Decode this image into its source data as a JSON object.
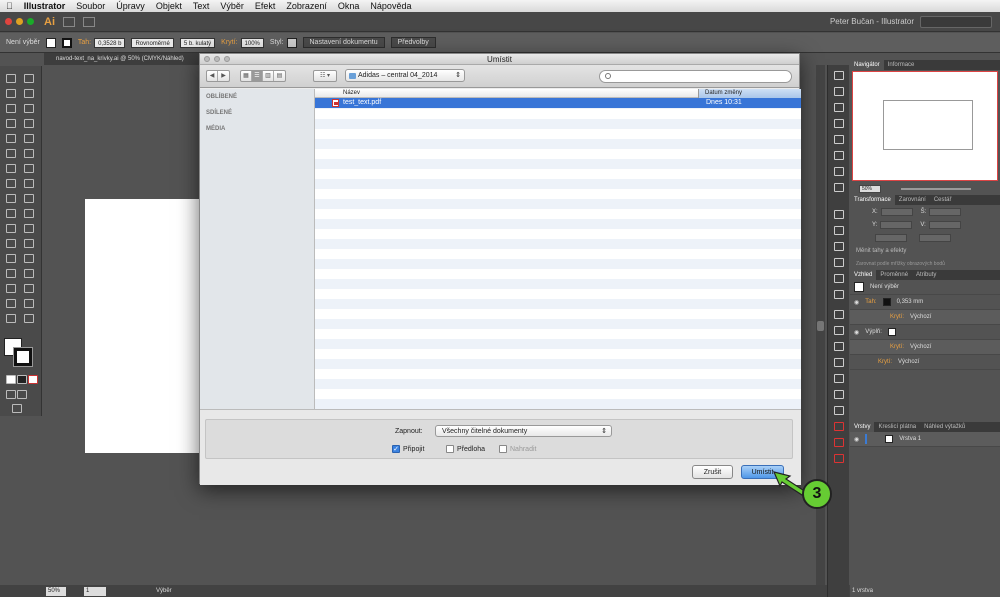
{
  "menubar": {
    "app": "Illustrator",
    "items": [
      "Soubor",
      "Úpravy",
      "Objekt",
      "Text",
      "Výběr",
      "Efekt",
      "Zobrazení",
      "Okna",
      "Nápověda"
    ]
  },
  "appbar": {
    "logo": "Ai",
    "user": "Peter Bučan - Illustrator"
  },
  "ctrlbar": {
    "selection": "Není výběr",
    "stroke_label": "Tah:",
    "stroke_value": "0,3528 b",
    "profile": "Rovnoměrné",
    "brush": "5 b. kulatý",
    "opacity_label": "Krytí:",
    "opacity_value": "100%",
    "style_label": "Styl:",
    "doc_setup": "Nastavení dokumentu",
    "prefs": "Předvolby"
  },
  "document": {
    "tab": "navod-text_na_krivky.ai @ 50% (CMYK/Náhled)"
  },
  "status": {
    "zoom": "50%",
    "page": "1",
    "mode": "Výběr"
  },
  "right_panel": {
    "nav_tabs": [
      "Navigátor",
      "Informace"
    ],
    "nav_zoom": "50%",
    "transform_tabs": [
      "Transformace",
      "Zarovnání",
      "Cestář"
    ],
    "t_x": "X:",
    "t_y": "Y:",
    "t_w": "Š:",
    "t_h": "V:",
    "scale_strokes": "Měnit tahy a efekty",
    "align_pixel": "Zarovnat podle mřížky obrazových bodů",
    "appearance_tabs": [
      "Vzhled",
      "Proměnné",
      "Atributy"
    ],
    "app_none": "Není výběr",
    "app_stroke_label": "Tah:",
    "app_stroke_value": "0,353 mm",
    "app_opacity_label": "Krytí:",
    "app_opacity_value": "Výchozí",
    "app_fill_label": "Výplň:",
    "app_fill_opacity_label": "Krytí:",
    "app_fill_opacity_value": "Výchozí",
    "app_all_opacity_label": "Krytí:",
    "app_all_opacity_value": "Výchozí",
    "layer_tabs": [
      "Vrstvy",
      "Kreslicí plátna",
      "Náhled výtažků"
    ],
    "layer_name": "Vrstva 1",
    "layer_count": "1 vrstva"
  },
  "dialog": {
    "title": "Umístit",
    "path": "Adidas – central 04_2014",
    "sidebar": [
      "OBLÍBENÉ",
      "SDÍLENÉ",
      "MÉDIA"
    ],
    "columns": {
      "name": "Název",
      "date": "Datum změny"
    },
    "files": [
      {
        "name": "test_text.pdf",
        "date": "Dnes 10:31"
      }
    ],
    "enable_label": "Zapnout:",
    "enable_value": "Všechny čitelné dokumenty",
    "link": "Připojit",
    "template": "Předloha",
    "replace": "Nahradit",
    "cancel": "Zrušit",
    "place": "Umístit"
  },
  "annotation": {
    "step": "3"
  },
  "colors": {
    "accent": "#3875d7",
    "badge": "#66cc33",
    "stroke_label": "#e8a042"
  }
}
